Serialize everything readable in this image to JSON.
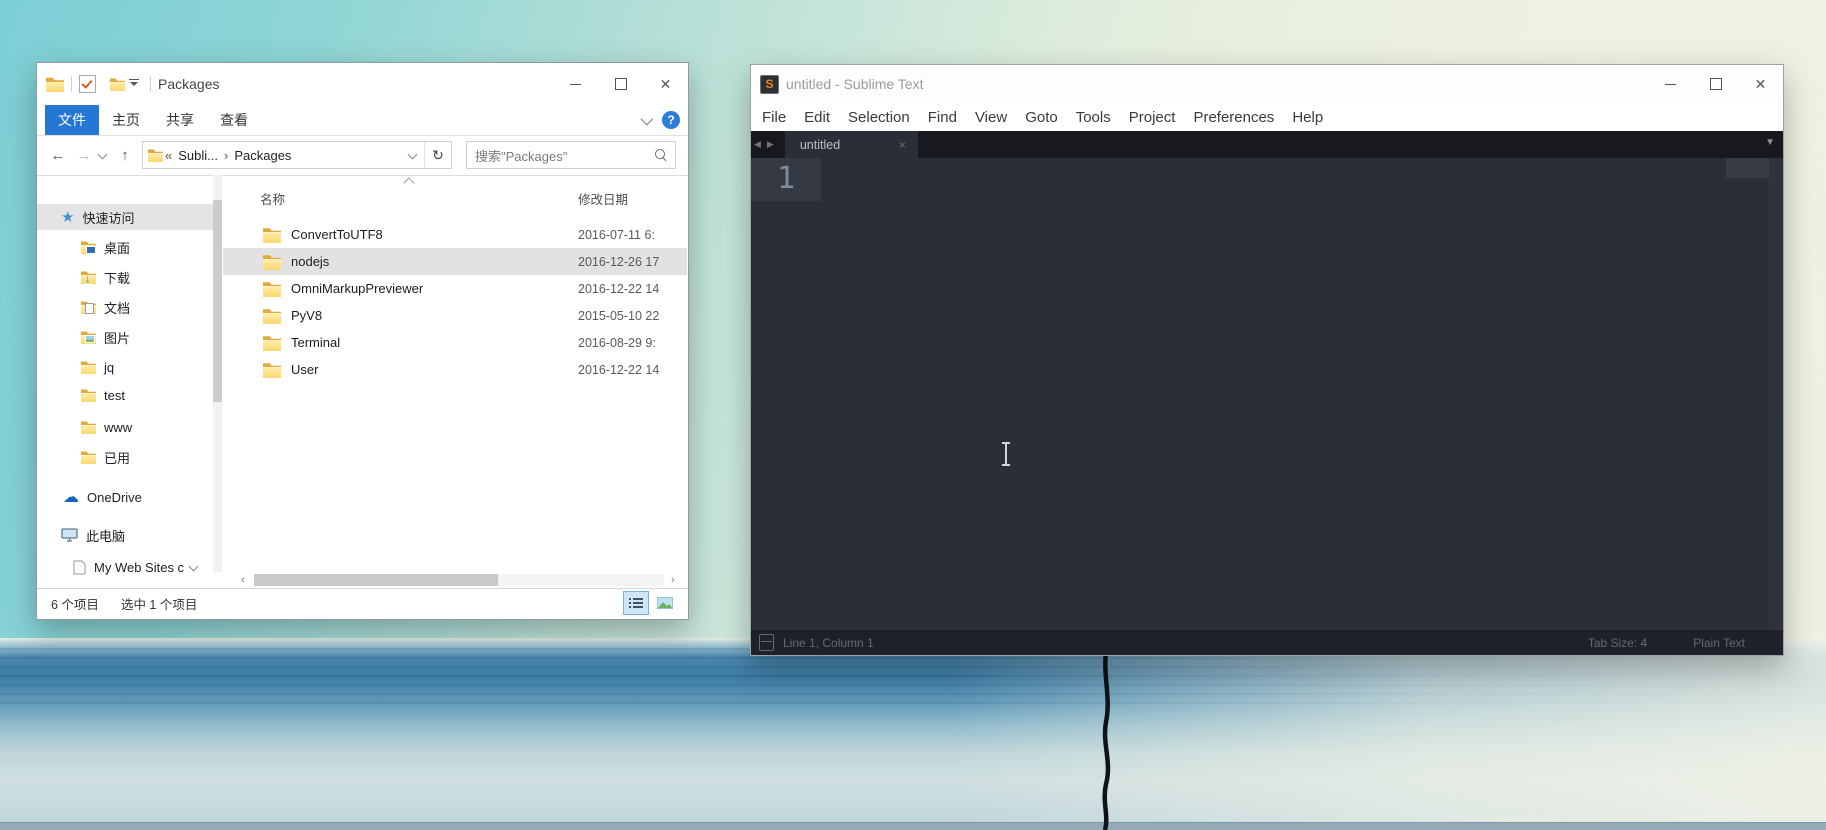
{
  "window_controls": {
    "close": "✕"
  },
  "explorer": {
    "title": "Packages",
    "ribbon_tabs": [
      "文件",
      "主页",
      "共享",
      "查看"
    ],
    "help_icon": "?",
    "nav": {
      "back": "←",
      "forward": "→",
      "up": "↑",
      "refresh": "↻"
    },
    "address": {
      "collapse": "«",
      "folder": "Subli...",
      "sep": "›",
      "current": "Packages"
    },
    "search": {
      "placeholder": "搜索\"Packages\""
    },
    "sidebar": [
      {
        "label": "快速访问"
      },
      {
        "label": "桌面"
      },
      {
        "label": "下载"
      },
      {
        "label": "文档"
      },
      {
        "label": "图片"
      },
      {
        "label": "jq"
      },
      {
        "label": "test"
      },
      {
        "label": "www"
      },
      {
        "label": "已用"
      },
      {
        "label": "OneDrive"
      },
      {
        "label": "此电脑"
      },
      {
        "label": "My Web Sites c"
      }
    ],
    "columns": {
      "name": "名称",
      "date": "修改日期"
    },
    "rows": [
      {
        "name": "ConvertToUTF8",
        "date": "2016-07-11 6:"
      },
      {
        "name": "nodejs",
        "date": "2016-12-26 17"
      },
      {
        "name": "OmniMarkupPreviewer",
        "date": "2016-12-22 14"
      },
      {
        "name": "PyV8",
        "date": "2015-05-10 22"
      },
      {
        "name": "Terminal",
        "date": "2016-08-29 9:"
      },
      {
        "name": "User",
        "date": "2016-12-22 14"
      }
    ],
    "status": {
      "count": "6 个项目",
      "selected": "选中 1 个项目"
    },
    "icons": {
      "star": "★",
      "cloud": "☁",
      "hleft": "‹",
      "hright": "›"
    }
  },
  "sublime": {
    "title": "untitled - Sublime Text",
    "icon_letter": "S",
    "menu": [
      "File",
      "Edit",
      "Selection",
      "Find",
      "View",
      "Goto",
      "Tools",
      "Project",
      "Preferences",
      "Help"
    ],
    "tab": {
      "label": "untitled",
      "close": "×",
      "nav_left": "◀",
      "nav_right": "▶",
      "list": "▼"
    },
    "editor": {
      "line1": "1"
    },
    "status": {
      "position": "Line 1, Column 1",
      "tab_size": "Tab Size: 4",
      "syntax": "Plain Text"
    }
  }
}
